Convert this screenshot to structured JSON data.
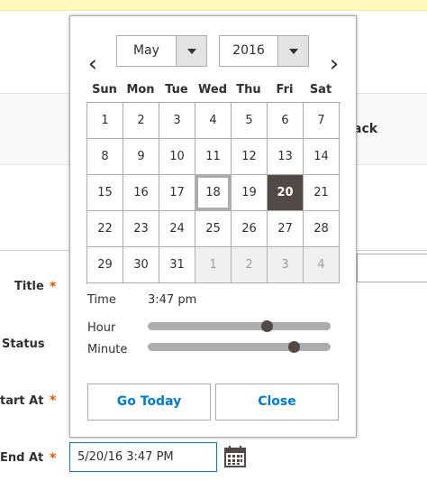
{
  "form": {
    "band_text": "ack",
    "labels": {
      "title": "Title",
      "status": "Status",
      "start_at": "tart At",
      "end_at": "End At"
    },
    "required_mark": "*",
    "end_at_value": "5/20/16 3:47 PM",
    "calendar_icon": "calendar-icon"
  },
  "datepicker": {
    "prev_icon": "‹",
    "next_icon": "›",
    "month": "May",
    "year": "2016",
    "weekdays": [
      "Sun",
      "Mon",
      "Tue",
      "Wed",
      "Thu",
      "Fri",
      "Sat"
    ],
    "weeks": [
      [
        {
          "d": "1"
        },
        {
          "d": "2"
        },
        {
          "d": "3"
        },
        {
          "d": "4"
        },
        {
          "d": "5"
        },
        {
          "d": "6"
        },
        {
          "d": "7"
        }
      ],
      [
        {
          "d": "8"
        },
        {
          "d": "9"
        },
        {
          "d": "10"
        },
        {
          "d": "11"
        },
        {
          "d": "12"
        },
        {
          "d": "13"
        },
        {
          "d": "14"
        }
      ],
      [
        {
          "d": "15"
        },
        {
          "d": "16"
        },
        {
          "d": "17"
        },
        {
          "d": "18",
          "today": true
        },
        {
          "d": "19"
        },
        {
          "d": "20",
          "selected": true
        },
        {
          "d": "21"
        }
      ],
      [
        {
          "d": "22"
        },
        {
          "d": "23"
        },
        {
          "d": "24"
        },
        {
          "d": "25"
        },
        {
          "d": "26"
        },
        {
          "d": "27"
        },
        {
          "d": "28"
        }
      ],
      [
        {
          "d": "29"
        },
        {
          "d": "30"
        },
        {
          "d": "31"
        },
        {
          "d": "1",
          "other": true
        },
        {
          "d": "2",
          "other": true
        },
        {
          "d": "3",
          "other": true
        },
        {
          "d": "4",
          "other": true
        }
      ]
    ],
    "time_label": "Time",
    "time_value": "3:47 pm",
    "hour_label": "Hour",
    "hour_value": 15,
    "minute_label": "Minute",
    "minute_value": 47,
    "go_today_label": "Go Today",
    "close_label": "Close",
    "colors": {
      "accent": "#007bdb",
      "selected_day": "#514943",
      "required": "#eb5202"
    }
  }
}
